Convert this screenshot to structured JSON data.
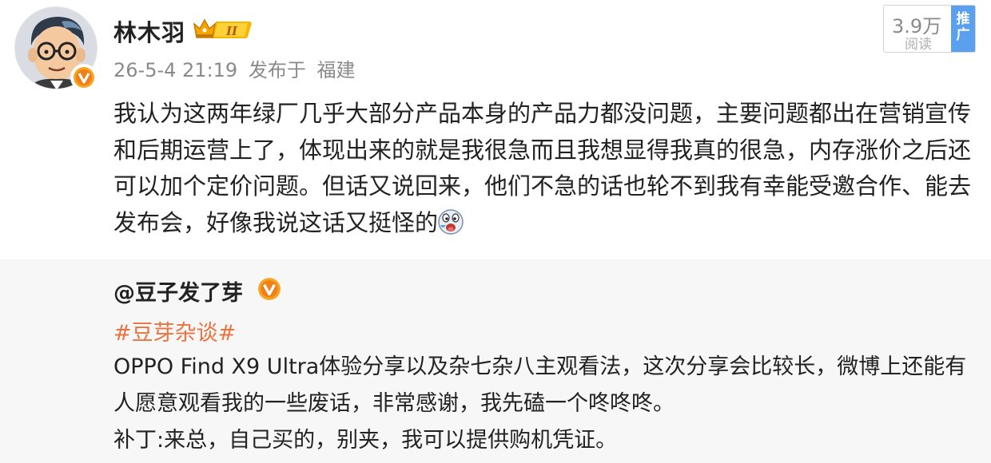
{
  "author": {
    "name": "林木羽",
    "badge_text": "II",
    "timestamp": "26-5-4 21:19",
    "source_label": "发布于",
    "location": "福建"
  },
  "stats": {
    "reads": "3.9万",
    "reads_label": "阅读",
    "promote_line1": "推",
    "promote_line2": "广"
  },
  "post": {
    "text": "我认为这两年绿厂几乎大部分产品本身的产品力都没问题，主要问题都出在营销宣传和后期运营上了，体现出来的就是我很急而且我想显得我真的很急，内存涨价之后还可以加个定价问题。但话又说回来，他们不急的话也轮不到我有幸能受邀合作、能去发布会，好像我说这话又挺怪的"
  },
  "repost": {
    "user": "@豆子发了芽",
    "topic": "#豆芽杂谈#",
    "line1": "OPPO Find X9 Ultra体验分享以及杂七杂八主观看法，这次分享会比较长，微博上还能有人愿意观看我的一些废话，非常感谢，我先磕一个咚咚咚。",
    "line2": "补丁:来总，自己买的，别夹，我可以提供购机凭证。"
  },
  "colors": {
    "topic": "#eb7340",
    "verified": "#f5a623",
    "promote": "#5aa0ee",
    "meta": "#8a8a8a"
  },
  "icons": [
    "verified-badge-icon",
    "crown-level-icon",
    "funny-face-emoji-icon"
  ]
}
